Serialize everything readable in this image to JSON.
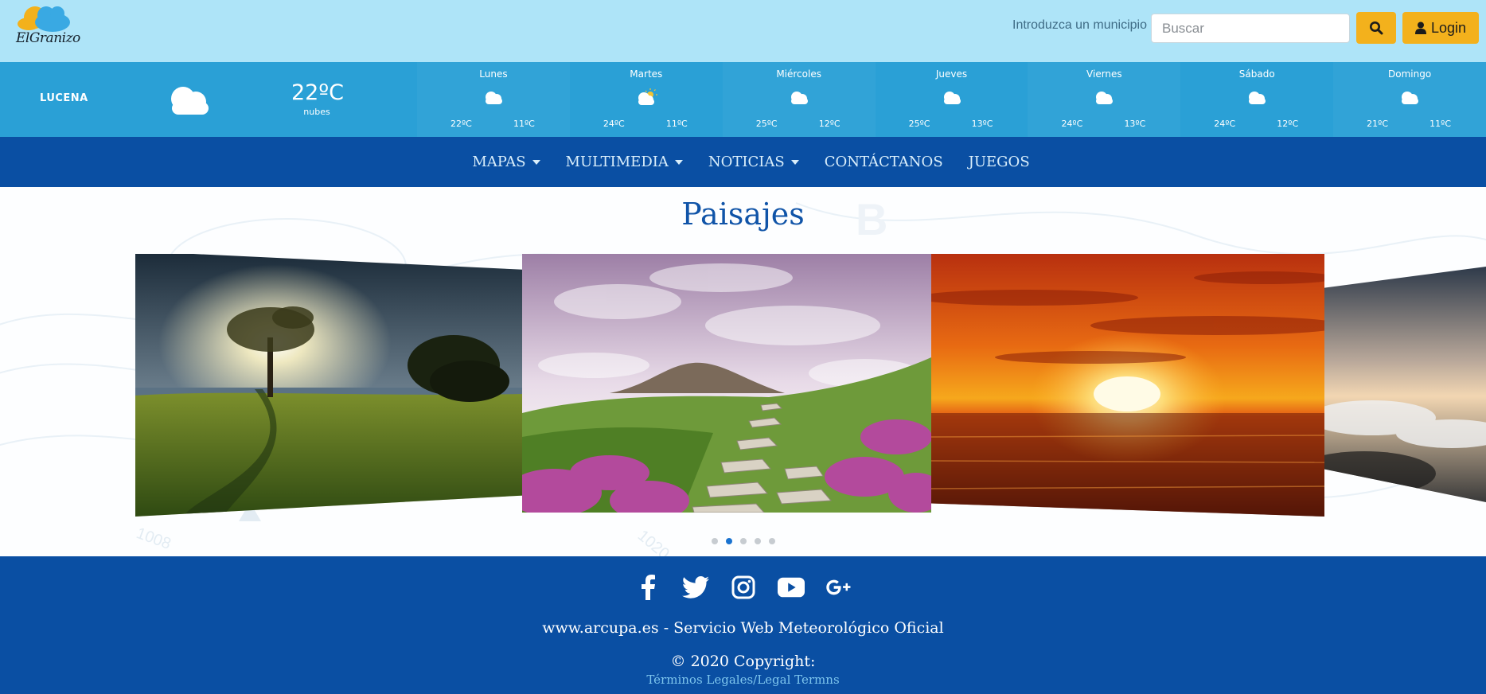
{
  "header": {
    "logo_text": "ElGranizo",
    "search_hint": "Introduzca un municipio",
    "search_placeholder": "Buscar",
    "login_label": "Login"
  },
  "weather": {
    "city": "LUCENA",
    "current_temp": "22ºC",
    "current_desc": "nubes",
    "days": [
      {
        "name": "Lunes",
        "icon": "cloud-icon",
        "max": "22ºC",
        "min": "11ºC"
      },
      {
        "name": "Martes",
        "icon": "sun-cloud-icon",
        "max": "24ºC",
        "min": "11ºC"
      },
      {
        "name": "Miércoles",
        "icon": "cloud-icon",
        "max": "25ºC",
        "min": "12ºC"
      },
      {
        "name": "Jueves",
        "icon": "cloud-icon",
        "max": "25ºC",
        "min": "13ºC"
      },
      {
        "name": "Viernes",
        "icon": "cloud-icon",
        "max": "24ºC",
        "min": "13ºC"
      },
      {
        "name": "Sábado",
        "icon": "cloud-icon",
        "max": "24ºC",
        "min": "12ºC"
      },
      {
        "name": "Domingo",
        "icon": "cloud-icon",
        "max": "21ºC",
        "min": "11ºC"
      }
    ]
  },
  "nav": {
    "items": [
      {
        "label": "MAPAS",
        "dropdown": true
      },
      {
        "label": "MULTIMEDIA",
        "dropdown": true
      },
      {
        "label": "NOTICIAS",
        "dropdown": true
      },
      {
        "label": "CONTÁCTANOS",
        "dropdown": false
      },
      {
        "label": "JUEGOS",
        "dropdown": false
      }
    ]
  },
  "main": {
    "title": "Paisajes",
    "carousel": {
      "slides": [
        "tree-sunset",
        "heather-path",
        "orange-sunset",
        "cloud-sea",
        "extra"
      ],
      "active_index": 1
    }
  },
  "footer": {
    "social": [
      "facebook-icon",
      "twitter-icon",
      "instagram-icon",
      "youtube-icon",
      "google-plus-icon"
    ],
    "site_line": "www.arcupa.es - Servicio Web Meteorológico Oficial",
    "copyright": "© 2020 Copyright:",
    "legal_link": "Términos Legales/Legal Termns"
  },
  "colors": {
    "topbar": "#aee4f8",
    "weather_strip": "#2aa0d6",
    "nav": "#0a4fa3",
    "accent_button": "#f3b11c",
    "title": "#1054a8",
    "footer_link": "#7ec6ee"
  }
}
